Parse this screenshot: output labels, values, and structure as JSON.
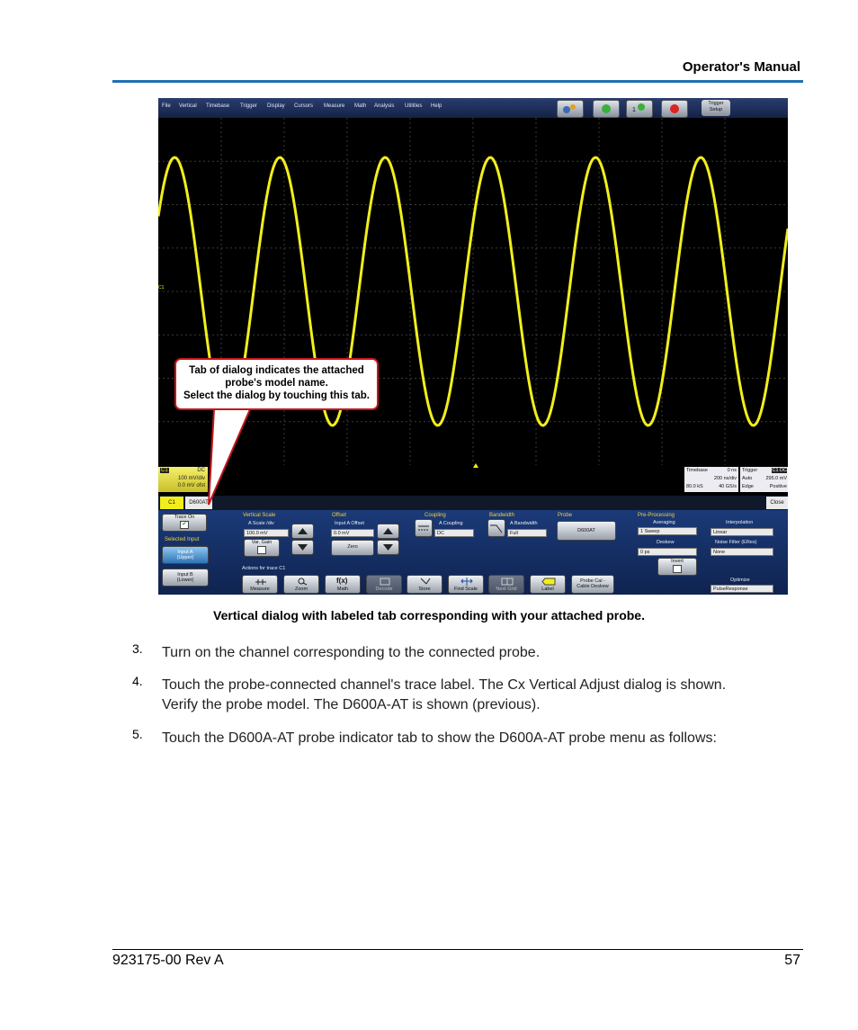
{
  "header": {
    "title": "Operator's Manual"
  },
  "screenshot": {
    "menu": [
      "File",
      "Vertical",
      "Timebase",
      "Trigger",
      "Display",
      "Cursors",
      "Measure",
      "Math",
      "Analysis",
      "Utilities",
      "Help"
    ],
    "toolbar_number": "1",
    "trigger_setup": [
      "Trigger",
      "Setup"
    ],
    "marker": "C1",
    "channel": {
      "name": "C1",
      "coupling": "DC",
      "scale": "100 mV/div",
      "offset": "0.0 mV ofst"
    },
    "timebase": {
      "label": "Timebase",
      "delay": "0 ns",
      "per_div": "200 ns/div",
      "samples": "80.0 kS",
      "rate": "40 GS/s"
    },
    "trigger": {
      "label": "Trigger",
      "source": "C1 DC",
      "mode": "Auto",
      "level": "295.0 mV",
      "type": "Edge",
      "slope": "Positive"
    },
    "tabs": {
      "c1": "C1",
      "probe": "D600AT",
      "close": "Close"
    },
    "dialog": {
      "trace_on": "Trace On",
      "selected_input": "Selected Input",
      "input_a": [
        "Input A",
        "(Upper)"
      ],
      "input_b": [
        "Input B",
        "(Lower)"
      ],
      "vertical_scale": "Vertical Scale",
      "a_scale_label": "A Scale /div",
      "a_scale_value": "100.0 mV",
      "var_gain": "Var. Gain",
      "offset": "Offset",
      "input_a_offset_label": "Input A Offset",
      "input_a_offset_value": "0.0 mV",
      "zero": "Zero",
      "coupling": "Coupling",
      "a_coupling_label": "A Coupling",
      "a_coupling_value": "DC",
      "bandwidth": "Bandwidth",
      "a_bandwidth_label": "A Bandwidth",
      "a_bandwidth_value": "Full",
      "probe": "Probe",
      "probe_button": "D600AT",
      "actions": "Actions for trace C1",
      "action_buttons": [
        "Measure",
        "Zoom",
        "Math",
        "Decode",
        "Store",
        "Find Scale",
        "Next Grid",
        "Label"
      ],
      "probe_cal": [
        "Probe Cal -",
        "Cable Deskew"
      ],
      "preproc": "Pre-Processing",
      "averaging": "Averaging",
      "averaging_value": "1 Sweep",
      "deskew": "Deskew",
      "deskew_value": "0 ps",
      "invert": "Invert",
      "interpolation": "Interpolation",
      "interpolation_value": "Linear",
      "noise_filter": "Noise Filter (ERes)",
      "noise_filter_value": "None",
      "optimize": "Optimize",
      "optimize_value": "PulseResponse"
    }
  },
  "callout": [
    "Tab of dialog indicates the attached",
    "probe's model name.",
    "Select the dialog by touching this tab."
  ],
  "caption": "Vertical dialog with labeled tab corresponding with your attached probe.",
  "steps": [
    {
      "num": "3.",
      "lines": [
        "Turn on the channel corresponding to the connected probe."
      ]
    },
    {
      "num": "4.",
      "lines": [
        "Touch the probe-connected channel's trace label. The Cx Vertical Adjust dialog is shown.",
        "Verify the probe model. The D600A-AT is shown (previous)."
      ]
    },
    {
      "num": "5.",
      "lines": [
        "Touch the D600A-AT probe indicator tab to show the D600A-AT probe menu as follows:"
      ]
    }
  ],
  "footer": {
    "doc": "923175-00 Rev A",
    "page": "57"
  }
}
